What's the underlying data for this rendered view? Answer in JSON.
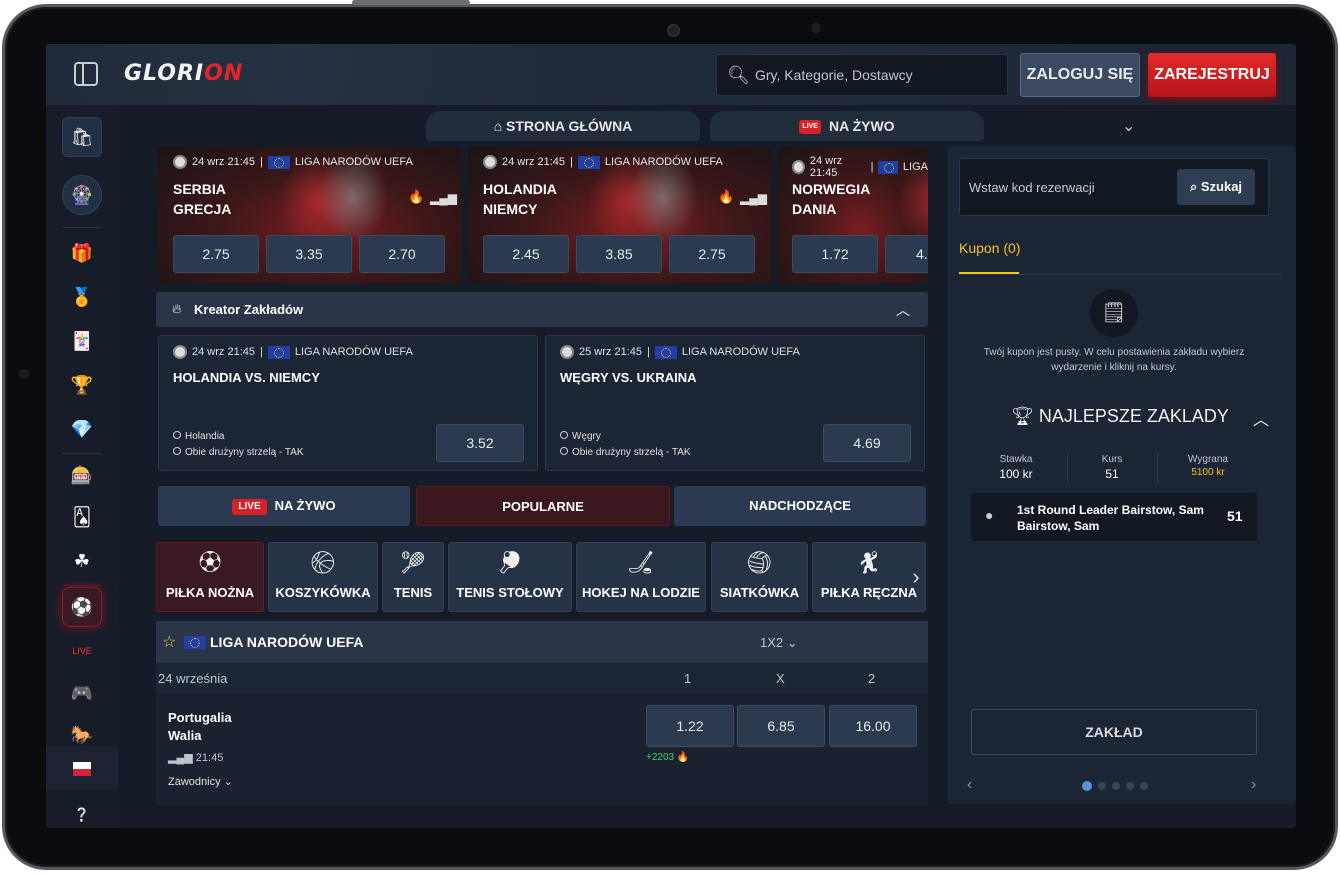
{
  "header": {
    "logo_a": "GLORI",
    "logo_b": "ON",
    "search_placeholder": "Gry, Kategorie, Dostawcy",
    "login": "ZALOGUJ SIĘ",
    "register": "ZAREJESTRUJ"
  },
  "nav": {
    "home": "STRONA GŁÓWNA",
    "live": "NA ŻYWO",
    "live_badge": "LIVE"
  },
  "featured": [
    {
      "date": "24 wrz 21:45",
      "league": "LIGA NARODÓW UEFA",
      "home": "SERBIA",
      "away": "GRECJA",
      "odds": [
        "2.75",
        "3.35",
        "2.70"
      ]
    },
    {
      "date": "24 wrz 21:45",
      "league": "LIGA NARODÓW UEFA",
      "home": "HOLANDIA",
      "away": "NIEMCY",
      "odds": [
        "2.45",
        "3.85",
        "2.75"
      ]
    },
    {
      "date": "24 wrz 21:45",
      "league": "LIGA",
      "home": "NORWEGIA",
      "away": "DANIA",
      "odds": [
        "1.72",
        "4."
      ]
    }
  ],
  "kreator": {
    "title": "Kreator Zakładów"
  },
  "builder": [
    {
      "date": "24 wrz 21:45",
      "league": "LIGA NARODÓW UEFA",
      "title": "HOLANDIA VS. NIEMCY",
      "sel1": "Holandia",
      "sel2": "Obie drużyny strzelą - TAK",
      "odd": "3.52"
    },
    {
      "date": "25 wrz 21:45",
      "league": "LIGA NARODÓW UEFA",
      "title": "WĘGRY VS. UKRAINA",
      "sel1": "Węgry",
      "sel2": "Obie drużyny strzelą - TAK",
      "odd": "4.69"
    }
  ],
  "tabs": {
    "live_badge": "LIVE",
    "live": "NA ŻYWO",
    "popular": "POPULARNE",
    "upcoming": "NADCHODZĄCE"
  },
  "sports": [
    "PIŁKA NOŻNA",
    "KOSZYKÓWKA",
    "TENIS",
    "TENIS STOŁOWY",
    "HOKEJ NA LODZIE",
    "SIATKÓWKA",
    "PIŁKA RĘCZNA"
  ],
  "league": {
    "name": "LIGA NARODÓW UEFA",
    "market": "1X2",
    "date": "24 września",
    "c1": "1",
    "cx": "X",
    "c2": "2"
  },
  "match": {
    "home": "Portugalia",
    "away": "Walia",
    "time": "21:45",
    "odds": [
      "1.22",
      "6.85",
      "16.00"
    ],
    "count": "+2203",
    "players": "Zawodnicy"
  },
  "coupon": {
    "placeholder": "Wstaw kod rezerwacji",
    "search": "Szukaj",
    "title": "Kupon (0)",
    "empty": "Twój kupon jest pusty. W celu postawienia zakładu wybierz wydarzenie i kliknij na kursy.",
    "best": "NAJLEPSZE ZAKLADY",
    "stawka_l": "Stawka",
    "stawka_v": "100 kr",
    "kurs_l": "Kurs",
    "kurs_v": "51",
    "wygrana_l": "Wygrana",
    "wygrana_v": "5100 kr",
    "leader_l1": "1st Round Leader Bairstow, Sam",
    "leader_l2": "Bairstow, Sam",
    "leader_odd": "51",
    "button": "ZAKŁAD"
  }
}
